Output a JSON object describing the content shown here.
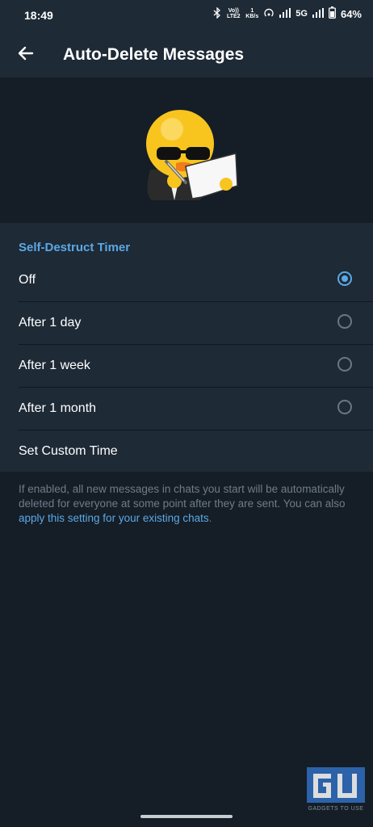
{
  "status_bar": {
    "time": "18:49",
    "volte": "Vo)) LTE2",
    "speed": "1 KB/s",
    "network": "5G",
    "battery": "64%"
  },
  "app_bar": {
    "back_icon": "arrow-left-icon",
    "title": "Auto-Delete Messages"
  },
  "settings": {
    "section_title": "Self-Destruct Timer",
    "options": [
      {
        "label": "Off",
        "selected": true
      },
      {
        "label": "After 1 day",
        "selected": false
      },
      {
        "label": "After 1 week",
        "selected": false
      },
      {
        "label": "After 1 month",
        "selected": false
      }
    ],
    "custom_label": "Set Custom Time"
  },
  "info": {
    "text": "If enabled, all new messages in chats you start will be automatically deleted for everyone at some point after they are sent. You can also ",
    "link": "apply this setting for your existing chats",
    "end": "."
  },
  "watermark": {
    "logo": "GU",
    "text": "GADGETS TO USE"
  },
  "colors": {
    "accent": "#5aa9e6",
    "background": "#151d26",
    "surface": "#1e2a36"
  }
}
